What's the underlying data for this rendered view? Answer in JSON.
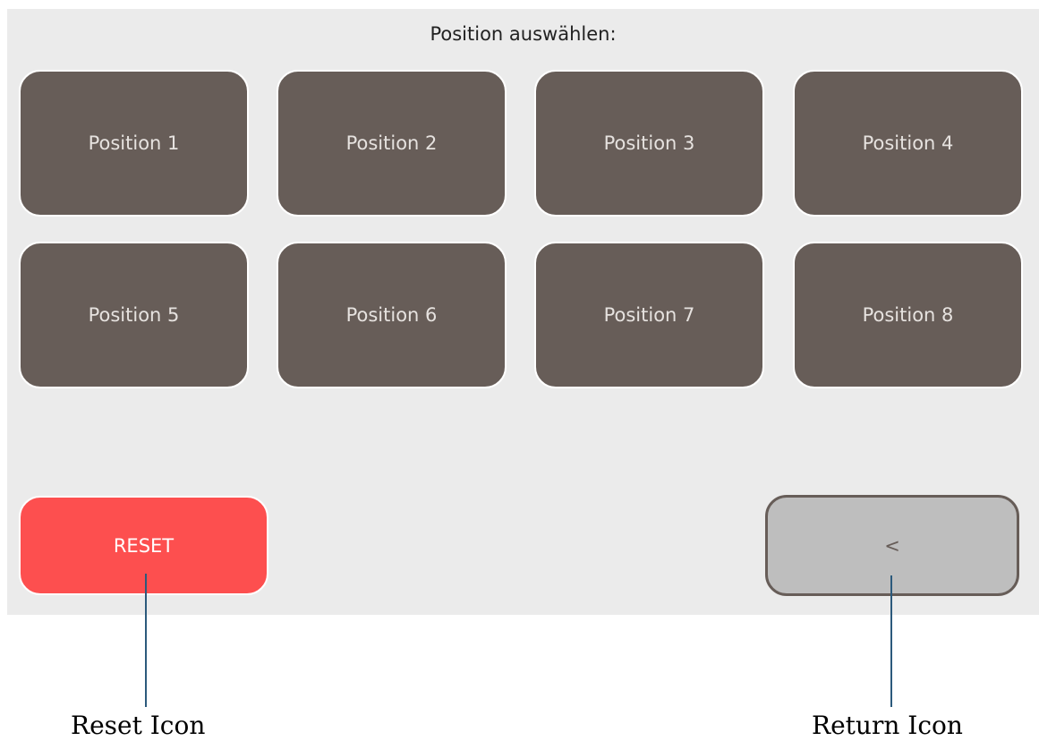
{
  "screen": {
    "title": "Position auswählen:",
    "positions": [
      {
        "label": "Position 1"
      },
      {
        "label": "Position 2"
      },
      {
        "label": "Position 3"
      },
      {
        "label": "Position 4"
      },
      {
        "label": "Position 5"
      },
      {
        "label": "Position 6"
      },
      {
        "label": "Position 7"
      },
      {
        "label": "Position 8"
      }
    ],
    "reset_label": "RESET",
    "return_label": "<"
  },
  "annotations": {
    "reset": "Reset Icon",
    "return": "Return Icon"
  },
  "colors": {
    "screen_bg": "#ebebeb",
    "position_button": "#675d58",
    "reset_button": "#fd4f4f",
    "return_button": "#bebebe",
    "callout_line": "#2c5a7c"
  }
}
